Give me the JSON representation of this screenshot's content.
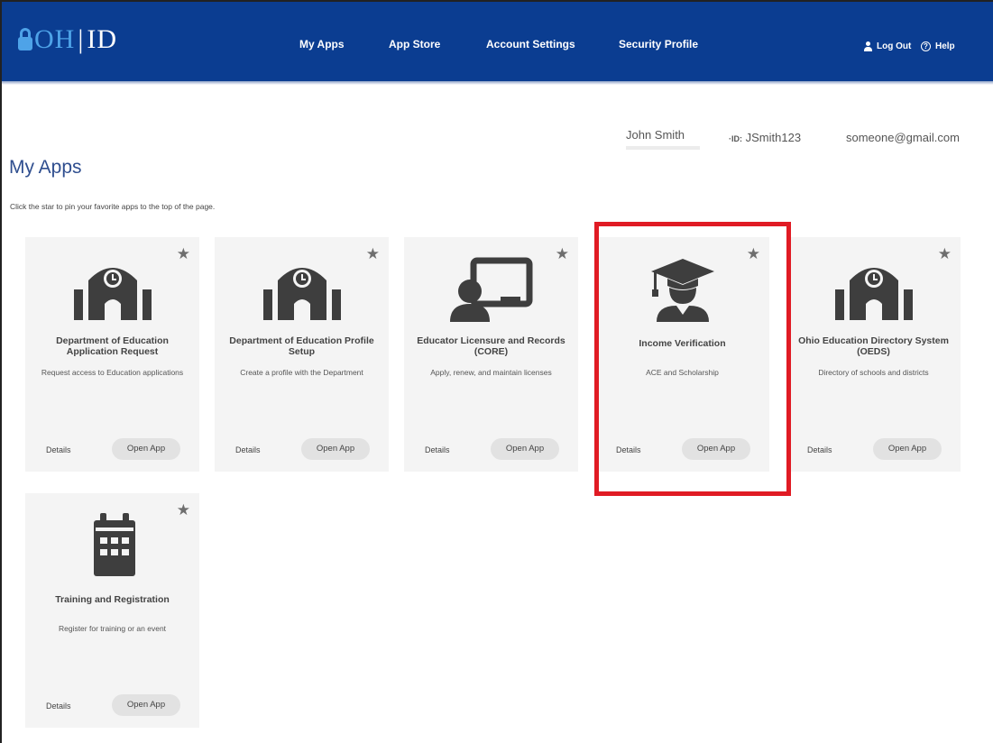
{
  "header": {
    "logo_oh": "OH",
    "logo_bar": "|",
    "logo_id": "ID",
    "nav": [
      "My Apps",
      "App Store",
      "Account Settings",
      "Security Profile"
    ],
    "logout_label": "Log Out",
    "help_label": "Help",
    "background_color": "#0b3d91"
  },
  "user": {
    "name": "John Smith",
    "id_prefix": "ID:",
    "id_value": "JSmith123",
    "email": "someone@gmail.com"
  },
  "page": {
    "title": "My Apps",
    "subtitle": "Click the star to pin your favorite apps to the top of the page."
  },
  "apps": [
    {
      "title": "Department of Education Application Request",
      "desc": "Request access to Education applications",
      "icon": "school-building-icon",
      "details": "Details",
      "open": "Open App"
    },
    {
      "title": "Department of Education Profile Setup",
      "desc": "Create a profile with the Department",
      "icon": "school-building-icon",
      "details": "Details",
      "open": "Open App"
    },
    {
      "title": "Educator Licensure and Records (CORE)",
      "desc": "Apply, renew, and maintain licenses",
      "icon": "teacher-board-icon",
      "details": "Details",
      "open": "Open App"
    },
    {
      "title": "Income Verification",
      "desc": "ACE and Scholarship",
      "icon": "graduate-icon",
      "details": "Details",
      "open": "Open App"
    },
    {
      "title": "Ohio Education Directory System (OEDS)",
      "desc": "Directory of schools and districts",
      "icon": "school-building-icon",
      "details": "Details",
      "open": "Open App"
    },
    {
      "title": "Training and Registration",
      "desc": "Register for training or an event",
      "icon": "calendar-icon",
      "details": "Details",
      "open": "Open App"
    }
  ],
  "highlight_color": "#e01b24"
}
